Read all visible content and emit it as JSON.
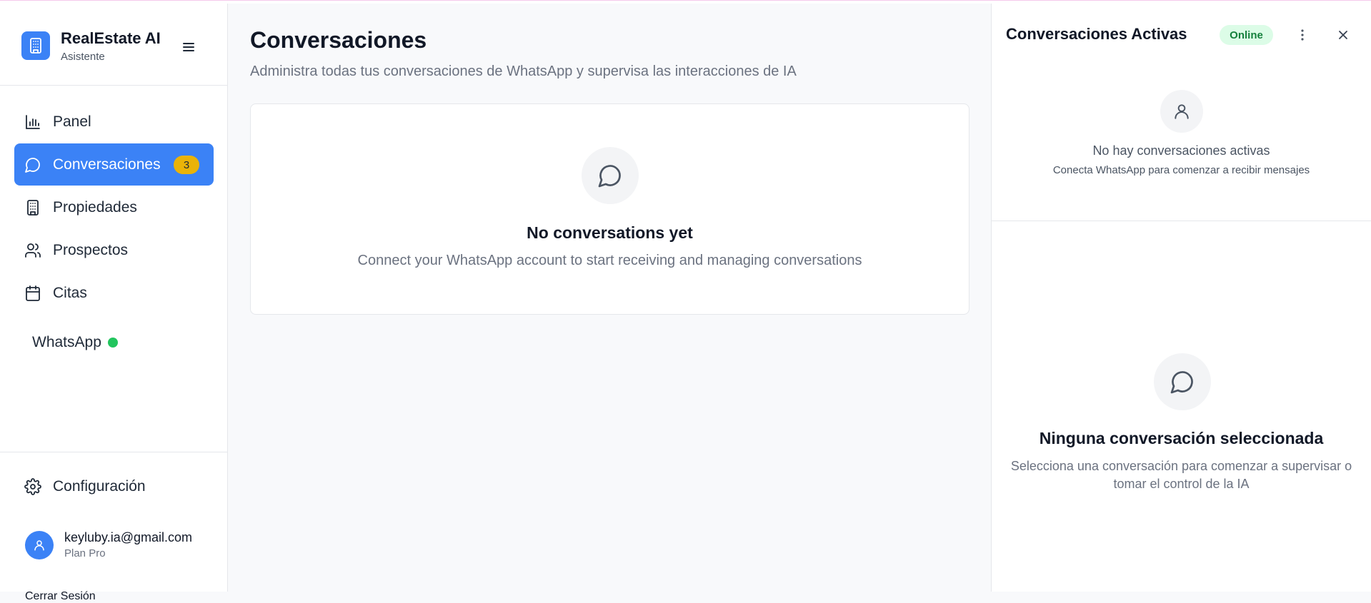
{
  "brand": {
    "title": "RealEstate AI",
    "subtitle": "Asistente",
    "icon": "building-icon"
  },
  "sidebar": {
    "items": [
      {
        "label": "Panel",
        "icon": "bar-chart-icon",
        "active": false
      },
      {
        "label": "Conversaciones",
        "icon": "message-circle-icon",
        "active": true,
        "badge": "3"
      },
      {
        "label": "Propiedades",
        "icon": "building-icon",
        "active": false
      },
      {
        "label": "Prospectos",
        "icon": "users-icon",
        "active": false
      },
      {
        "label": "Citas",
        "icon": "calendar-icon",
        "active": false
      }
    ],
    "whatsapp": {
      "label": "WhatsApp",
      "status_color": "#22c55e"
    },
    "settings_label": "Configuración",
    "user": {
      "email": "keyluby.ia@gmail.com",
      "plan": "Plan Pro"
    },
    "logout_label": "Cerrar Sesión"
  },
  "main": {
    "title": "Conversaciones",
    "subtitle": "Administra todas tus conversaciones de WhatsApp y supervisa las interacciones de IA",
    "empty": {
      "title": "No conversations yet",
      "description": "Connect your WhatsApp account to start receiving and managing conversations"
    }
  },
  "right_panel": {
    "title": "Conversaciones Activas",
    "status_badge": "Online",
    "empty_active": {
      "title": "No hay conversaciones activas",
      "description": "Conecta WhatsApp para comenzar a recibir mensajes"
    },
    "no_selection": {
      "title": "Ninguna conversación seleccionada",
      "description": "Selecciona una conversación para comenzar a supervisar o tomar el control de la IA"
    }
  },
  "colors": {
    "accent": "#3b82f6",
    "badge": "#eab308",
    "online_bg": "#dcfce7",
    "online_text": "#15803d"
  }
}
